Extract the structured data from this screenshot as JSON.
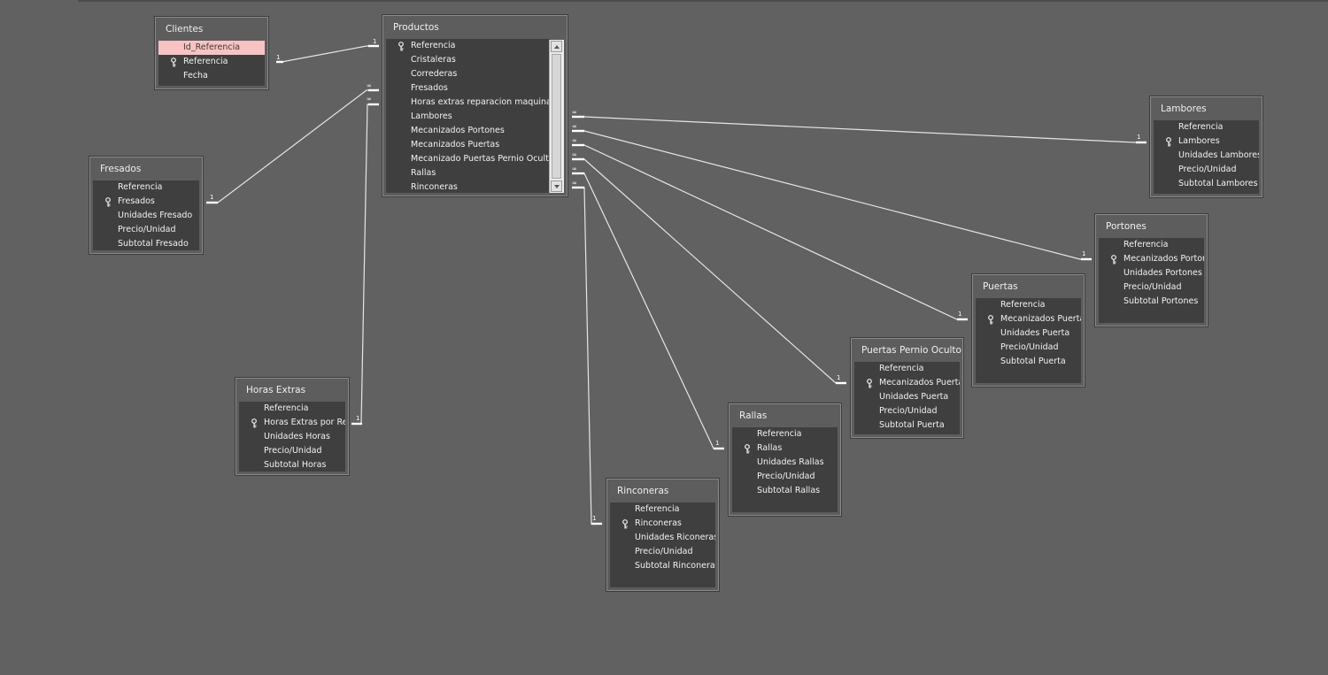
{
  "tables": {
    "clientes": {
      "title": "Clientes",
      "fields": [
        "Id_Referencia",
        "Referencia",
        "Fecha"
      ]
    },
    "productos": {
      "title": "Productos",
      "fields": [
        "Referencia",
        "Cristaleras",
        "Correderas",
        "Fresados",
        "Horas extras reparacion maquina",
        "Lambores",
        "Mecanizados Portones",
        "Mecanizados Puertas",
        "Mecanizado Puertas Pernio Oculto",
        "Rallas",
        "Rinconeras"
      ]
    },
    "fresados": {
      "title": "Fresados",
      "fields": [
        "Referencia",
        "Fresados",
        "Unidades Fresado",
        "Precio/Unidad",
        "Subtotal Fresado"
      ]
    },
    "horas": {
      "title": "Horas Extras",
      "fields": [
        "Referencia",
        "Horas Extras por Rep",
        "Unidades Horas",
        "Precio/Unidad",
        "Subtotal Horas"
      ]
    },
    "lambores": {
      "title": "Lambores",
      "fields": [
        "Referencia",
        "Lambores",
        "Unidades Lambores",
        "Precio/Unidad",
        "Subtotal Lambores"
      ]
    },
    "portones": {
      "title": "Portones",
      "fields": [
        "Referencia",
        "Mecanizados Porton",
        "Unidades Portones",
        "Precio/Unidad",
        "Subtotal Portones"
      ]
    },
    "puertas": {
      "title": "Puertas",
      "fields": [
        "Referencia",
        "Mecanizados Puerta",
        "Unidades Puerta",
        "Precio/Unidad",
        "Subtotal Puerta"
      ]
    },
    "pernio": {
      "title": "Puertas Pernio Oculto",
      "fields": [
        "Referencia",
        "Mecanizados Puerta",
        "Unidades Puerta",
        "Precio/Unidad",
        "Subtotal Puerta"
      ]
    },
    "rallas": {
      "title": "Rallas",
      "fields": [
        "Referencia",
        "Rallas",
        "Unidades Rallas",
        "Precio/Unidad",
        "Subtotal Rallas"
      ]
    },
    "rinconeras": {
      "title": "Rinconeras",
      "fields": [
        "Referencia",
        "Rinconeras",
        "Unidades Riconeras",
        "Precio/Unidad",
        "Subtotal Rinconeras"
      ]
    }
  },
  "relationship_labels": {
    "one": "1",
    "many": "∞"
  },
  "colors": {
    "canvas": "#616161",
    "selected_field": "#f9c3c3",
    "line": "#e6e6e6"
  }
}
